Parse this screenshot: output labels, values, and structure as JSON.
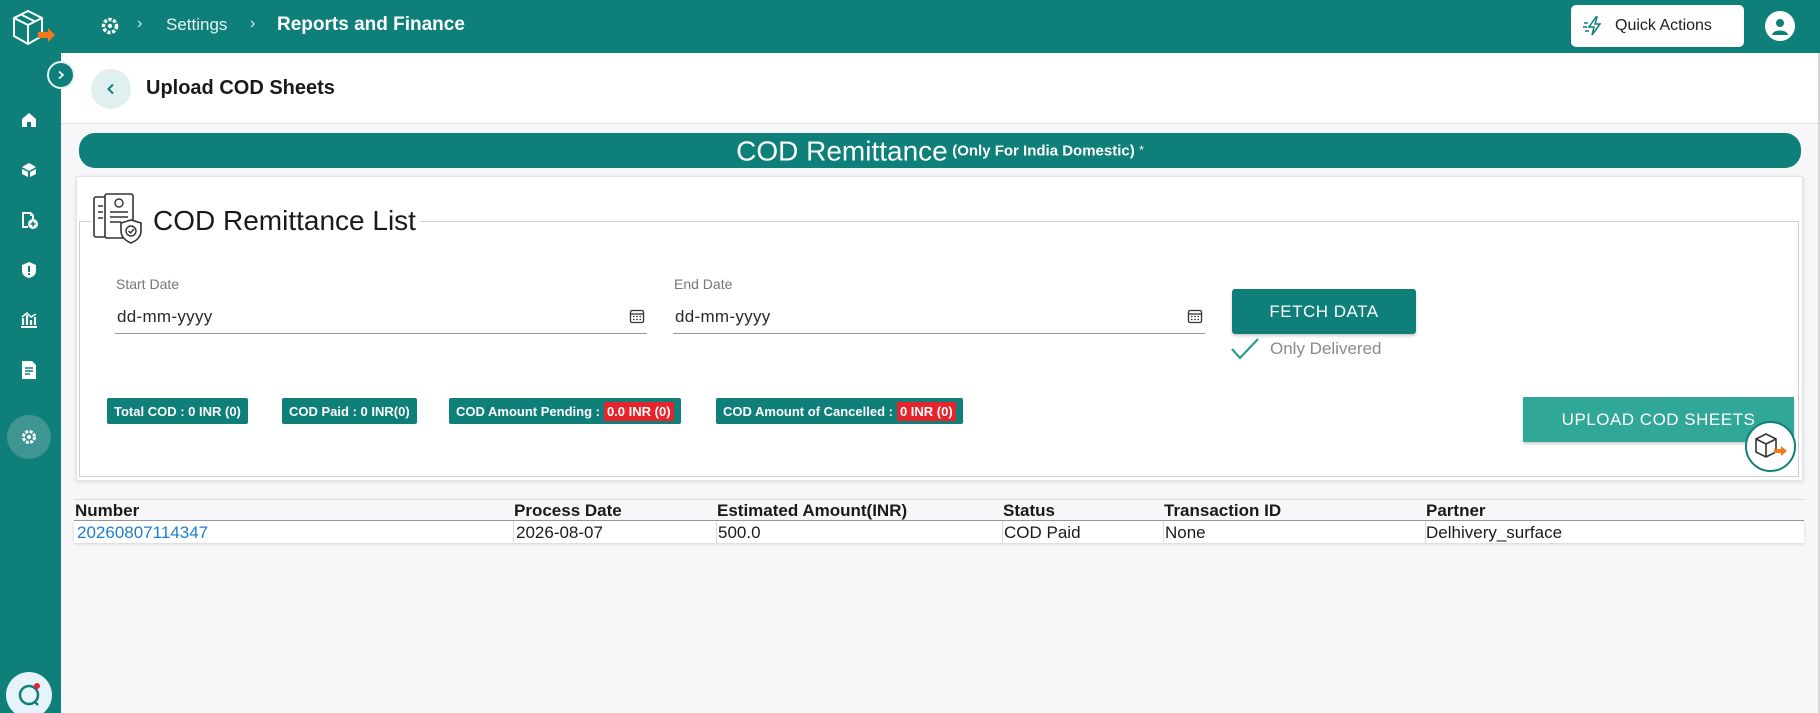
{
  "topbar": {
    "breadcrumb_settings": "Settings",
    "breadcrumb_current": "Reports and Finance",
    "quick_actions_label": "Quick Actions"
  },
  "page": {
    "title": "Upload COD Sheets"
  },
  "banner": {
    "title": "COD Remittance",
    "note": "(Only For India Domestic)",
    "asterisk": "*"
  },
  "card": {
    "title": "COD Remittance List",
    "start_date": {
      "label": "Start Date",
      "value": "dd-mm-yyyy"
    },
    "end_date": {
      "label": "End Date",
      "value": "dd-mm-yyyy"
    },
    "fetch_label": "FETCH DATA",
    "only_delivered_label": "Only Delivered",
    "only_delivered_checked": true,
    "badges": {
      "total_cod": {
        "label": "Total COD :",
        "value": "0 INR (0)"
      },
      "cod_paid": {
        "label": "COD Paid :",
        "value": "0 INR(0)"
      },
      "pending": {
        "label": "COD Amount Pending :",
        "value": "0.0 INR (0)"
      },
      "cancelled": {
        "label": "COD Amount of Cancelled :",
        "value": "0 INR (0)"
      }
    },
    "upload_label": "UPLOAD COD SHEETS"
  },
  "table": {
    "columns": [
      "Number",
      "Process Date",
      "Estimated Amount(INR)",
      "Status",
      "Transaction ID",
      "Partner"
    ],
    "rows": [
      [
        "20260807114347",
        "2026-08-07",
        "500.0",
        "COD Paid",
        "None",
        "Delhivery_surface"
      ]
    ]
  },
  "colors": {
    "primary": "#0f7f7a",
    "upload_button": "#31a797",
    "danger": "#e5242b",
    "link": "#1a7fd1"
  },
  "icons": {
    "sidebar": [
      "home-icon",
      "box-icon",
      "add-document-icon",
      "alert-icon",
      "bank-icon",
      "report-icon",
      "settings-icon"
    ],
    "header": [
      "settings-icon",
      "lightning-icon",
      "user-icon"
    ]
  }
}
